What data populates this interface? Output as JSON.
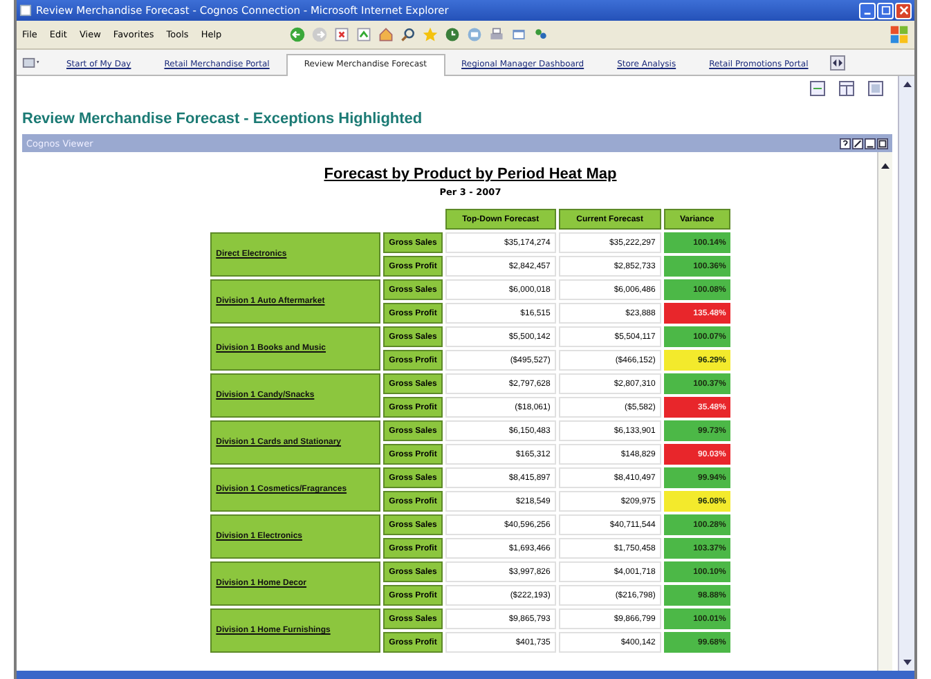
{
  "window": {
    "title": "Review Merchandise Forecast - Cognos Connection - Microsoft Internet Explorer"
  },
  "menu": [
    "File",
    "Edit",
    "View",
    "Favorites",
    "Tools",
    "Help"
  ],
  "tabs": [
    {
      "label": "Start of My Day",
      "selected": false
    },
    {
      "label": "Retail Merchandise Portal",
      "selected": false
    },
    {
      "label": "Review Merchandise Forecast",
      "selected": true
    },
    {
      "label": "Regional Manager Dashboard",
      "selected": false
    },
    {
      "label": "Store Analysis",
      "selected": false
    },
    {
      "label": "Retail Promotions Portal",
      "selected": false
    }
  ],
  "page_title": "Review Merchandise Forecast - Exceptions Highlighted",
  "viewer": {
    "title": "Cognos Viewer"
  },
  "report": {
    "title": "Forecast by Product by Period Heat Map",
    "subtitle": "Per 3 - 2007",
    "columns": [
      "Top-Down Forecast",
      "Current Forecast",
      "Variance"
    ],
    "groups": [
      {
        "name": "Direct Electronics",
        "rows": [
          {
            "measure": "Gross Sales",
            "top_down": "$35,174,274",
            "current": "$35,222,297",
            "variance": "100.14%",
            "color": "#4cb847"
          },
          {
            "measure": "Gross Profit",
            "top_down": "$2,842,457",
            "current": "$2,852,733",
            "variance": "100.36%",
            "color": "#4cb847"
          }
        ]
      },
      {
        "name": "Division 1 Auto Aftermarket",
        "rows": [
          {
            "measure": "Gross Sales",
            "top_down": "$6,000,018",
            "current": "$6,006,486",
            "variance": "100.08%",
            "color": "#4cb847"
          },
          {
            "measure": "Gross Profit",
            "top_down": "$16,515",
            "current": "$23,888",
            "variance": "135.48%",
            "color": "#e8262b"
          }
        ]
      },
      {
        "name": "Division 1 Books and Music",
        "rows": [
          {
            "measure": "Gross Sales",
            "top_down": "$5,500,142",
            "current": "$5,504,117",
            "variance": "100.07%",
            "color": "#4cb847"
          },
          {
            "measure": "Gross Profit",
            "top_down": "($495,527)",
            "current": "($466,152)",
            "variance": "96.29%",
            "color": "#f3ea2c"
          }
        ]
      },
      {
        "name": "Division 1 Candy/Snacks",
        "rows": [
          {
            "measure": "Gross Sales",
            "top_down": "$2,797,628",
            "current": "$2,807,310",
            "variance": "100.37%",
            "color": "#4cb847"
          },
          {
            "measure": "Gross Profit",
            "top_down": "($18,061)",
            "current": "($5,582)",
            "variance": "35.48%",
            "color": "#e8262b"
          }
        ]
      },
      {
        "name": "Division 1 Cards and Stationary",
        "rows": [
          {
            "measure": "Gross Sales",
            "top_down": "$6,150,483",
            "current": "$6,133,901",
            "variance": "99.73%",
            "color": "#4cb847"
          },
          {
            "measure": "Gross Profit",
            "top_down": "$165,312",
            "current": "$148,829",
            "variance": "90.03%",
            "color": "#e8262b"
          }
        ]
      },
      {
        "name": "Division 1 Cosmetics/Fragrances",
        "rows": [
          {
            "measure": "Gross Sales",
            "top_down": "$8,415,897",
            "current": "$8,410,497",
            "variance": "99.94%",
            "color": "#4cb847"
          },
          {
            "measure": "Gross Profit",
            "top_down": "$218,549",
            "current": "$209,975",
            "variance": "96.08%",
            "color": "#f3ea2c"
          }
        ]
      },
      {
        "name": "Division 1 Electronics",
        "rows": [
          {
            "measure": "Gross Sales",
            "top_down": "$40,596,256",
            "current": "$40,711,544",
            "variance": "100.28%",
            "color": "#4cb847"
          },
          {
            "measure": "Gross Profit",
            "top_down": "$1,693,466",
            "current": "$1,750,458",
            "variance": "103.37%",
            "color": "#4cb847"
          }
        ]
      },
      {
        "name": "Division 1 Home Decor",
        "rows": [
          {
            "measure": "Gross Sales",
            "top_down": "$3,997,826",
            "current": "$4,001,718",
            "variance": "100.10%",
            "color": "#4cb847"
          },
          {
            "measure": "Gross Profit",
            "top_down": "($222,193)",
            "current": "($216,798)",
            "variance": "98.88%",
            "color": "#4cb847"
          }
        ]
      },
      {
        "name": "Division 1 Home Furnishings",
        "rows": [
          {
            "measure": "Gross Sales",
            "top_down": "$9,865,793",
            "current": "$9,866,799",
            "variance": "100.01%",
            "color": "#4cb847"
          },
          {
            "measure": "Gross Profit",
            "top_down": "$401,735",
            "current": "$400,142",
            "variance": "99.68%",
            "color": "#4cb847"
          }
        ]
      }
    ]
  }
}
